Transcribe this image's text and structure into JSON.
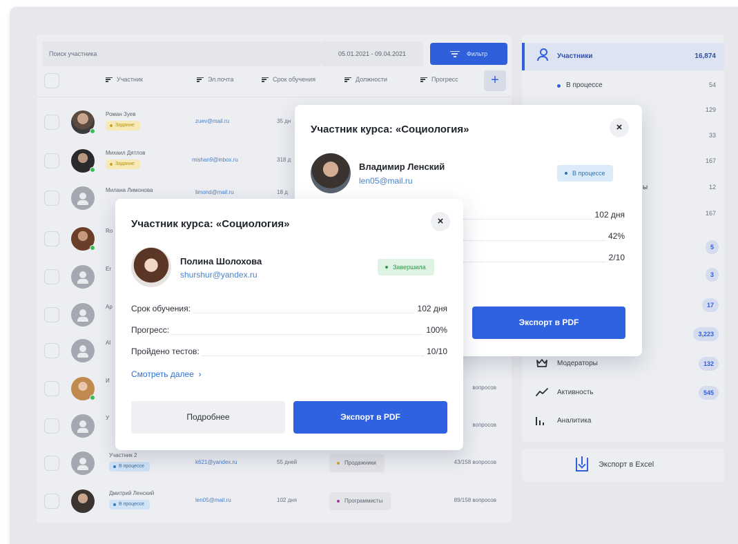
{
  "search": {
    "placeholder": "Поиск участника"
  },
  "date_range": "05.01.2021 - 09.04.2021",
  "filter_label": "Фильтр",
  "columns": [
    "Участник",
    "Эл.почта",
    "Срок обучения",
    "Должности",
    "Прогресс"
  ],
  "rows": [
    {
      "name": "Роман Зуев",
      "badge": "Задание",
      "email": "zuev@mail.ru",
      "days": "35 дн",
      "position": "",
      "progress": ""
    },
    {
      "name": "Михаил Дятлов",
      "badge": "Задание",
      "email": "mishan9@inbox.ru",
      "days": "318 д",
      "position": "",
      "progress": ""
    },
    {
      "name": "Милана Лимонова",
      "badge": "",
      "email": "limond@mail.ru",
      "days": "18 д",
      "position": "",
      "progress": ""
    },
    {
      "name": "Ro",
      "badge": "",
      "email": "",
      "days": "",
      "position": "",
      "progress": ""
    },
    {
      "name": "Er",
      "badge": "",
      "email": "",
      "days": "",
      "position": "",
      "progress": ""
    },
    {
      "name": "Ap",
      "badge": "",
      "email": "",
      "days": "",
      "position": "",
      "progress": ""
    },
    {
      "name": "Al",
      "badge": "",
      "email": "",
      "days": "",
      "position": "",
      "progress": ""
    },
    {
      "name": "И",
      "badge": "",
      "email": "",
      "days": "",
      "position": "",
      "progress": "вопросов"
    },
    {
      "name": "У",
      "badge": "",
      "email": "",
      "days": "",
      "position": "",
      "progress": "вопросов"
    },
    {
      "name": "Участник 2",
      "badge": "В процессе",
      "email": "k621@yandex.ru",
      "days": "55 дней",
      "position": "Продажники",
      "progress": "43/158 вопросов"
    },
    {
      "name": "Дмитрий Ленский",
      "badge": "В процессе",
      "email": "len05@mail.ru",
      "days": "102 дня",
      "position": "Программисты",
      "progress": "89/158 вопросов"
    }
  ],
  "sidebar": {
    "title": "Участники",
    "count": "16,874",
    "sub_label": "В процессе",
    "numbers": [
      "54",
      "129",
      "33",
      "167",
      "12",
      "167"
    ],
    "pills": [
      "5",
      "3",
      "17",
      "3,223"
    ],
    "moderators_label": "Модераторы",
    "moderators_count": "132",
    "activity_label": "Активность",
    "activity_count": "545",
    "analytics_label": "Аналитика",
    "partial_label": "ы"
  },
  "export_excel": "Экспорт в Excel",
  "modal_back": {
    "title": "Участник курса: «Социология»",
    "close": "×",
    "name": "Владимир Ленский",
    "email": "len05@mail.ru",
    "status": "В процессе",
    "values": [
      "102 дня",
      "42%",
      "2/10"
    ],
    "export": "Экспорт в PDF"
  },
  "modal_front": {
    "title": "Участник курса: «Социология»",
    "close": "×",
    "name": "Полина Шолохова",
    "email": "shurshur@yandex.ru",
    "status": "Завершила",
    "stats": [
      {
        "label": "Срок обучения:",
        "value": "102 дня"
      },
      {
        "label": "Прогресс:",
        "value": "100%"
      },
      {
        "label": "Пройдено тестов:",
        "value": "10/10"
      }
    ],
    "more": "Смотреть далее",
    "more_arrow": "›",
    "details": "Подробнее",
    "export": "Экспорт в PDF"
  },
  "colors": {
    "accent": "#2f62e0",
    "background": "#e7e8ec"
  }
}
